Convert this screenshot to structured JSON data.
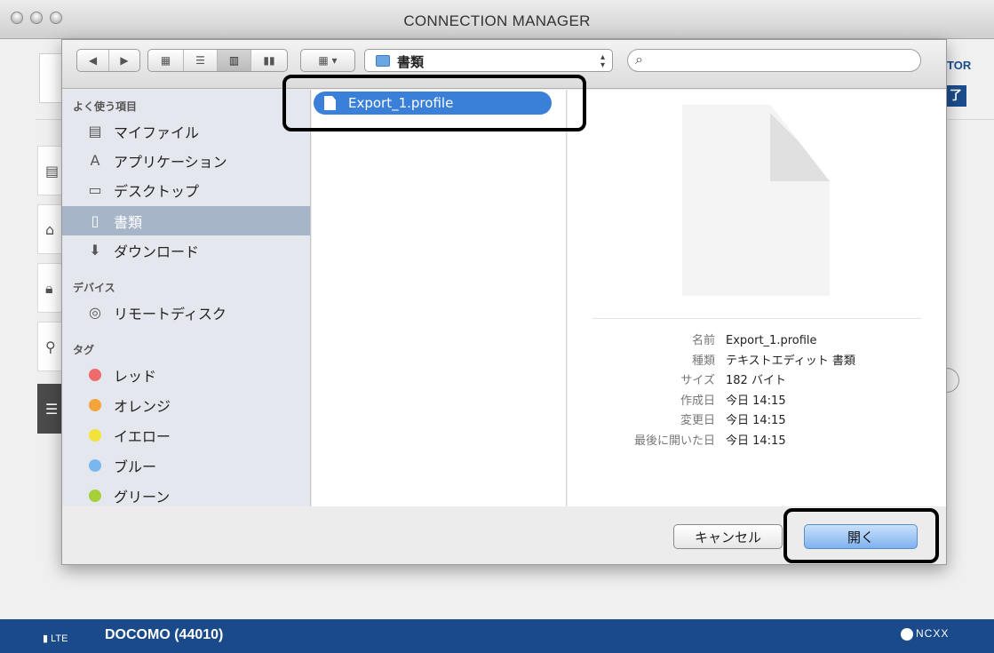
{
  "window": {
    "title": "CONNECTION MANAGER"
  },
  "background": {
    "partial_label": "TOR",
    "partial_badge": "了"
  },
  "status_bar": {
    "signal": "LTE",
    "carrier": "DOCOMO (44010)",
    "brand": "NCXX"
  },
  "dialog": {
    "path": "書類",
    "search_placeholder": "",
    "sidebar": {
      "favorites_header": "よく使う項目",
      "favorites": [
        {
          "label": "マイファイル",
          "icon": "my-files-icon"
        },
        {
          "label": "アプリケーション",
          "icon": "applications-icon"
        },
        {
          "label": "デスクトップ",
          "icon": "desktop-icon"
        },
        {
          "label": "書類",
          "icon": "documents-icon",
          "selected": true
        },
        {
          "label": "ダウンロード",
          "icon": "downloads-icon"
        }
      ],
      "devices_header": "デバイス",
      "devices": [
        {
          "label": "リモートディスク",
          "icon": "remote-disc-icon"
        }
      ],
      "tags_header": "タグ",
      "tags": [
        {
          "label": "レッド",
          "color": "#ee6b6b"
        },
        {
          "label": "オレンジ",
          "color": "#f5a33b"
        },
        {
          "label": "イエロー",
          "color": "#f2e23a"
        },
        {
          "label": "ブルー",
          "color": "#7bb7ef"
        },
        {
          "label": "グリーン",
          "color": "#a6cf3a"
        }
      ]
    },
    "file_list": [
      {
        "name": "Export_1.profile",
        "selected": true
      }
    ],
    "preview": {
      "name_key": "名前",
      "name": "Export_1.profile",
      "kind_key": "種類",
      "kind": "テキストエディット 書類",
      "size_key": "サイズ",
      "size": "182 バイト",
      "created_key": "作成日",
      "created": "今日 14:15",
      "modified_key": "変更日",
      "modified": "今日 14:15",
      "opened_key": "最後に開いた日",
      "opened": "今日 14:15"
    },
    "buttons": {
      "cancel": "キャンセル",
      "open": "開く"
    }
  }
}
